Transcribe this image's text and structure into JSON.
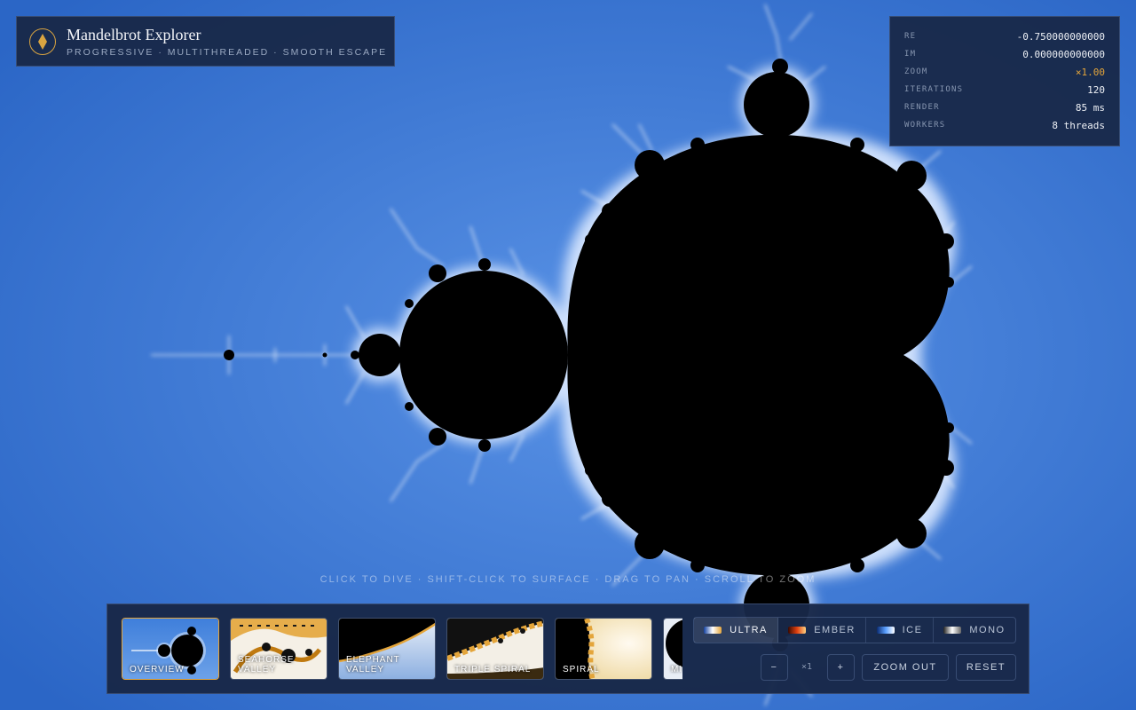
{
  "app": {
    "title": "Mandelbrot Explorer",
    "subtitle": "PROGRESSIVE · MULTITHREADED · SMOOTH ESCAPE",
    "logo_icon": "compass-diamond-icon",
    "accent_color": "#e4a53a"
  },
  "stats": {
    "re_label": "RE",
    "re_value": "-0.750000000000",
    "im_label": "IM",
    "im_value": "0.000000000000",
    "zoom_label": "ZOOM",
    "zoom_value": "×1.00",
    "iterations_label": "ITERATIONS",
    "iterations_value": "120",
    "render_label": "RENDER",
    "render_value": "85 ms",
    "workers_label": "WORKERS",
    "workers_value": "8 threads"
  },
  "hint": "CLICK TO DIVE · SHIFT-CLICK TO SURFACE · DRAG TO PAN · SCROLL TO ZOOM",
  "presets": [
    {
      "label": "OVERVIEW",
      "active": true
    },
    {
      "label": "SEAHORSE\nVALLEY",
      "active": false
    },
    {
      "label": "ELEPHANT\nVALLEY",
      "active": false
    },
    {
      "label": "TRIPLE SPIRAL",
      "active": false
    },
    {
      "label": "SPIRAL",
      "active": false
    },
    {
      "label": "MI",
      "active": false
    }
  ],
  "palettes": [
    {
      "label": "ULTRA",
      "active": true
    },
    {
      "label": "EMBER",
      "active": false
    },
    {
      "label": "ICE",
      "active": false
    },
    {
      "label": "MONO",
      "active": false
    }
  ],
  "controls": {
    "zoom_minus": "−",
    "zoom_level": "×1",
    "zoom_plus": "+",
    "zoom_out": "ZOOM OUT",
    "reset": "RESET"
  },
  "colors": {
    "background_blue": "#2f6fcf",
    "set_black": "#000000",
    "panel": "#182848"
  }
}
